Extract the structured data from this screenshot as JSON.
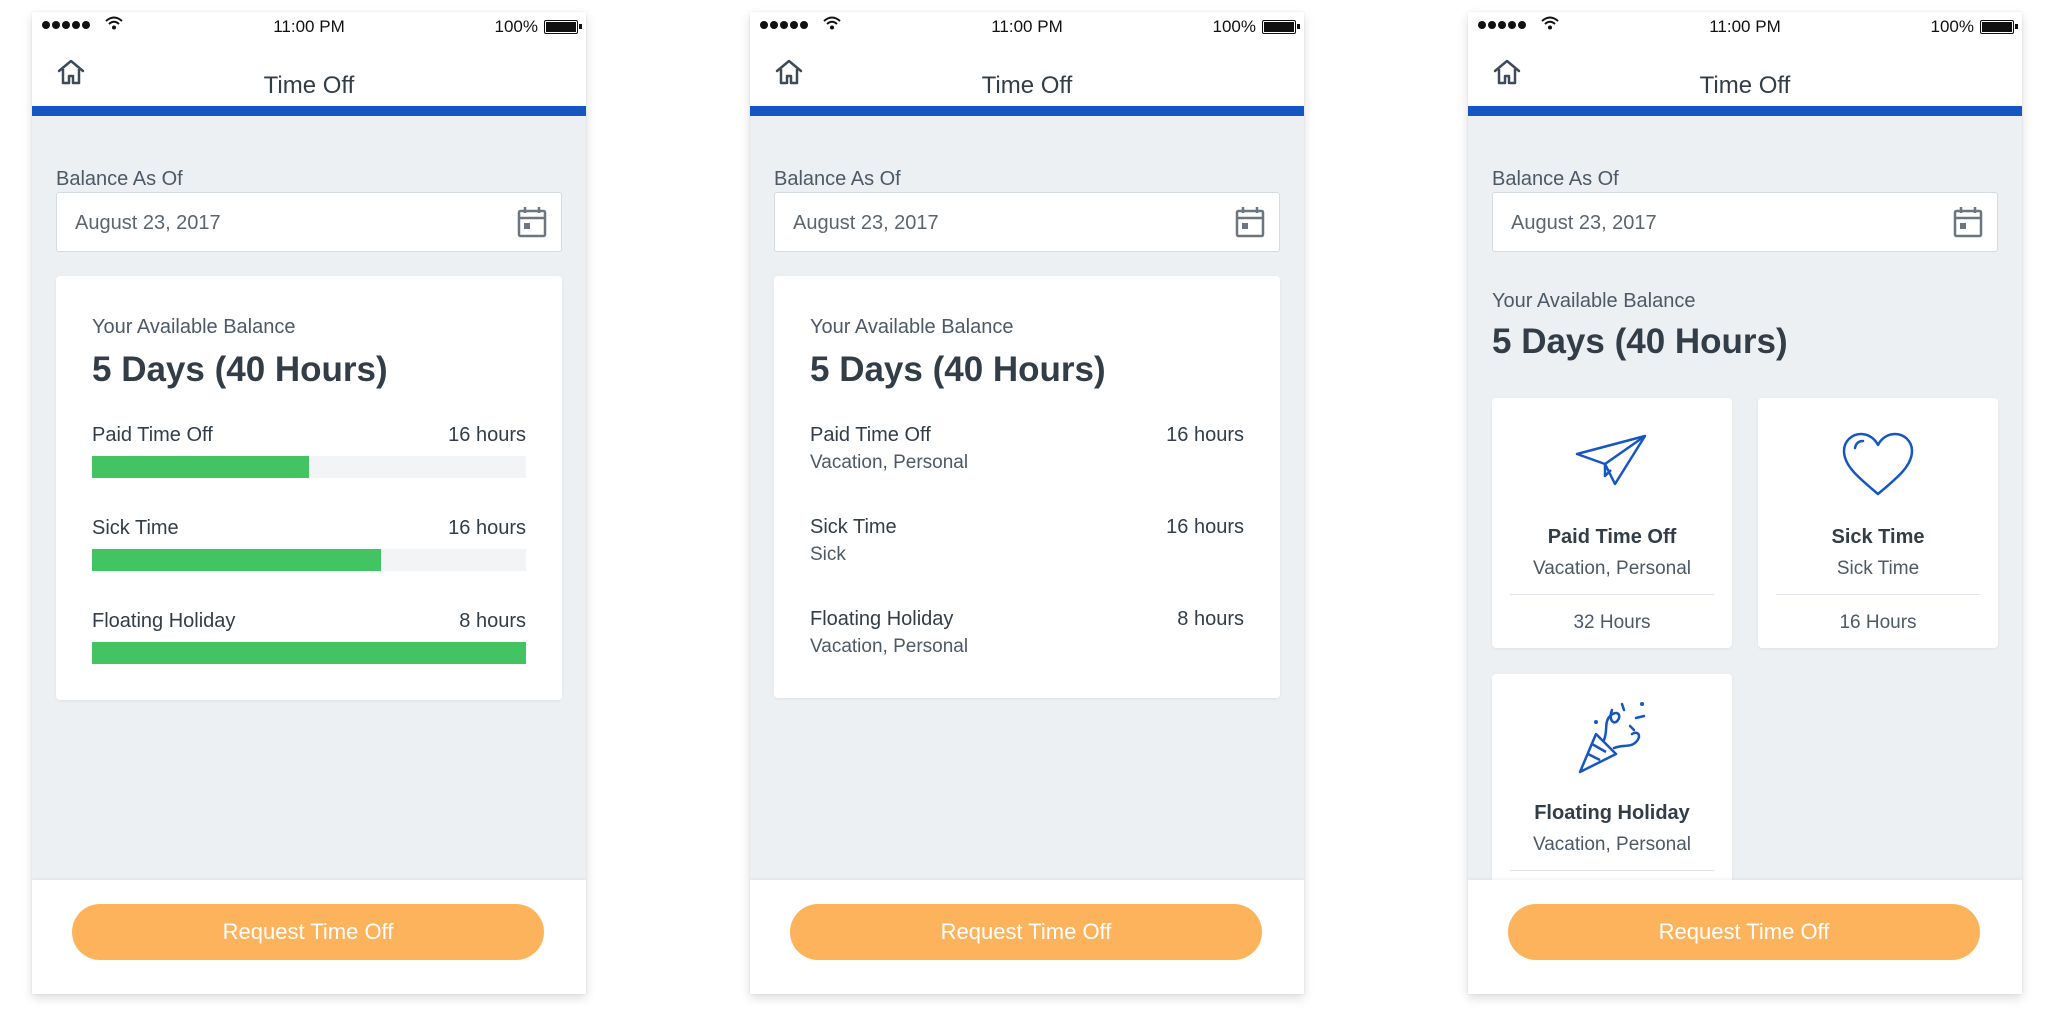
{
  "colors": {
    "accent": "#1656c3",
    "progress": "#43c463",
    "button": "#fdb35c",
    "background": "#edf0f3"
  },
  "phones": [
    {
      "status": {
        "time": "11:00 PM",
        "battery": "100%"
      },
      "header": {
        "title": "Time Off",
        "home_icon": "home-icon"
      },
      "balance_as_of_label": "Balance As Of",
      "date_value": "August 23, 2017",
      "calendar_icon": "calendar-icon",
      "available_label": "Your Available Balance",
      "available_value": "5 Days (40 Hours)",
      "rows": [
        {
          "name": "Paid Time Off",
          "hours": "16 hours",
          "progress": 0.5
        },
        {
          "name": "Sick Time",
          "hours": "16 hours",
          "progress": 0.665
        },
        {
          "name": "Floating Holiday",
          "hours": "8 hours",
          "progress": 1.0
        }
      ],
      "button_label": "Request Time Off"
    },
    {
      "status": {
        "time": "11:00 PM",
        "battery": "100%"
      },
      "header": {
        "title": "Time Off",
        "home_icon": "home-icon"
      },
      "balance_as_of_label": "Balance As Of",
      "date_value": "August 23, 2017",
      "calendar_icon": "calendar-icon",
      "available_label": "Your Available Balance",
      "available_value": "5 Days (40 Hours)",
      "rows": [
        {
          "name": "Paid Time Off",
          "hours": "16 hours",
          "sub": "Vacation, Personal"
        },
        {
          "name": "Sick Time",
          "hours": "16 hours",
          "sub": "Sick"
        },
        {
          "name": "Floating Holiday",
          "hours": "8 hours",
          "sub": "Vacation, Personal"
        }
      ],
      "button_label": "Request Time Off"
    },
    {
      "status": {
        "time": "11:00 PM",
        "battery": "100%"
      },
      "header": {
        "title": "Time Off",
        "home_icon": "home-icon"
      },
      "balance_as_of_label": "Balance As Of",
      "date_value": "August 23, 2017",
      "calendar_icon": "calendar-icon",
      "available_label": "Your Available Balance",
      "available_value": "5 Days (40 Hours)",
      "tiles": [
        {
          "name": "Paid Time Off",
          "sub": "Vacation, Personal",
          "hours": "32 Hours",
          "icon": "paper-plane-icon"
        },
        {
          "name": "Sick Time",
          "sub": "Sick Time",
          "hours": "16 Hours",
          "icon": "heart-icon"
        },
        {
          "name": "Floating Holiday",
          "sub": "Vacation, Personal",
          "hours": "",
          "icon": "party-popper-icon"
        }
      ],
      "button_label": "Request Time Off"
    }
  ]
}
